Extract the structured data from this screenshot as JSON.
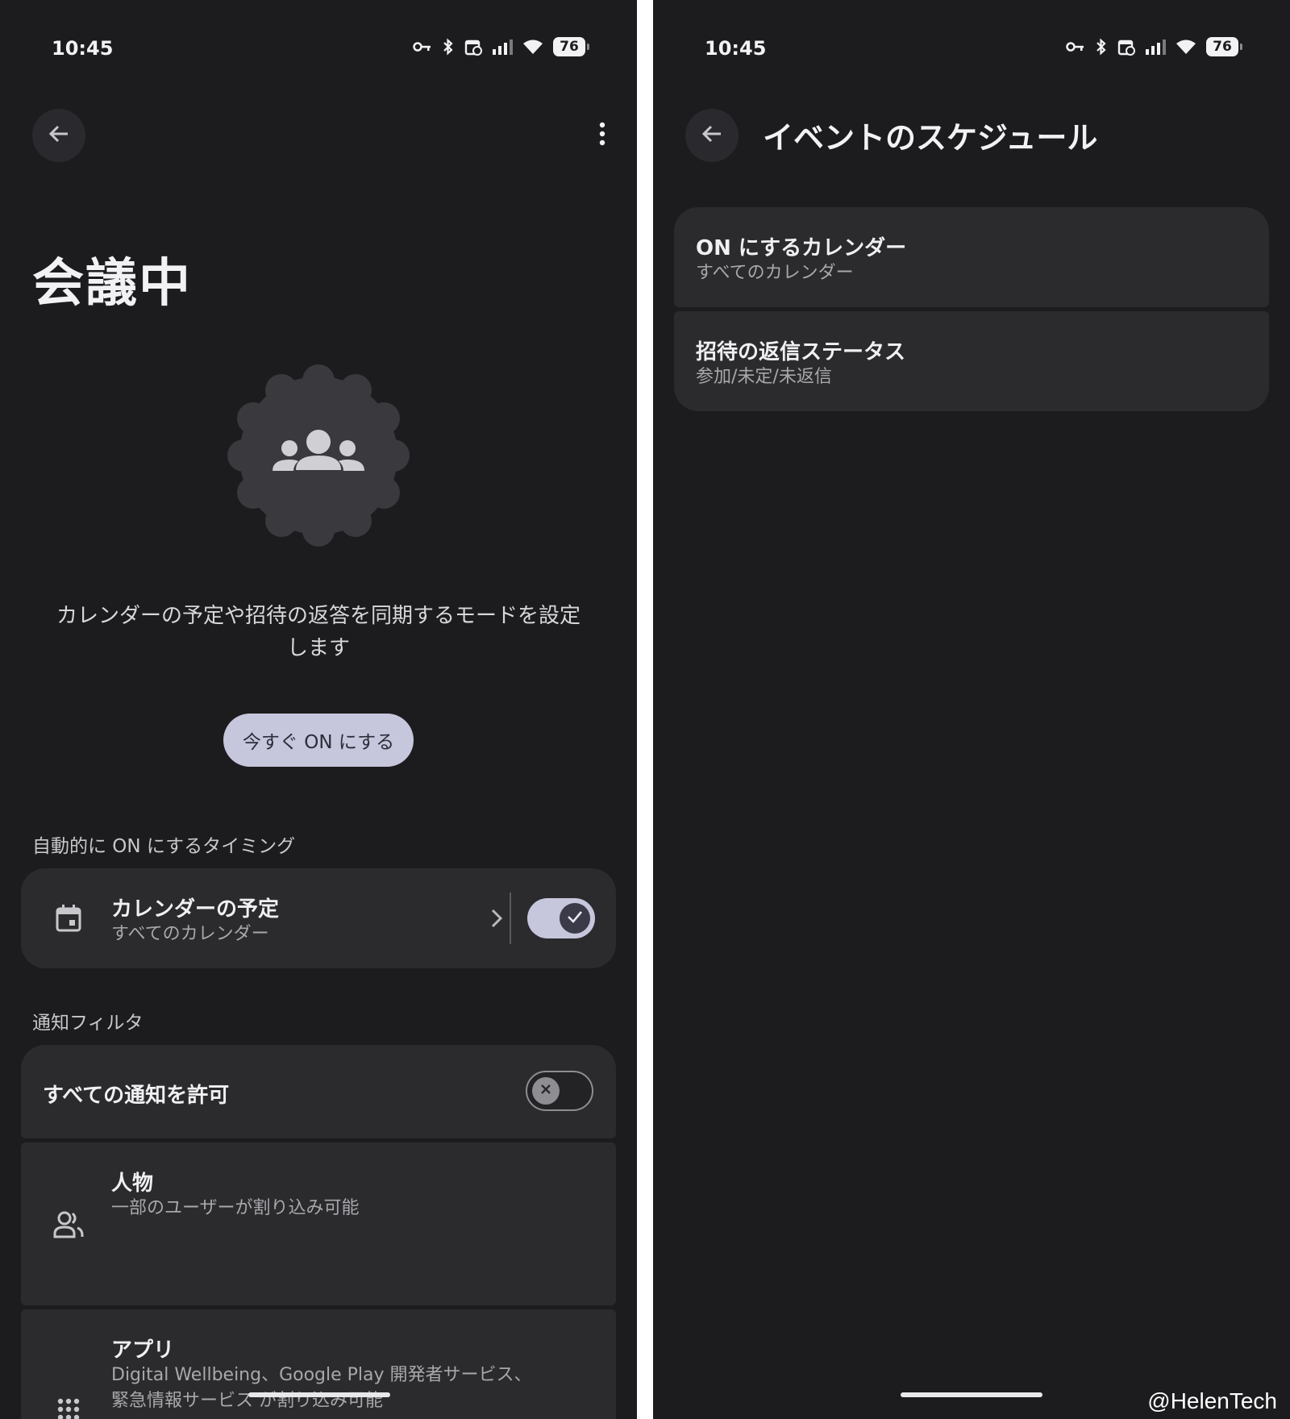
{
  "left_screen": {
    "status": {
      "time": "10:45",
      "battery": "76"
    },
    "title": "会議中",
    "description": "カレンダーの予定や招待の返答を同期するモードを設定します",
    "primary_button": "今すぐ ON にする",
    "schedule_section": {
      "label": "自動的に ON にするタイミング",
      "item": {
        "title": "カレンダーの予定",
        "subtitle": "すべてのカレンダー",
        "toggle": "on"
      }
    },
    "filter_section": {
      "label": "通知フィルタ",
      "allow_all": {
        "title": "すべての通知を許可",
        "toggle": "off"
      },
      "people": {
        "title": "人物",
        "subtitle": "一部のユーザーが割り込み可能"
      },
      "apps": {
        "title": "アプリ",
        "subtitle_line1": "Digital Wellbeing、Google Play 開発者サービス、",
        "subtitle_line2": "緊急情報サービス が割り込み可能"
      }
    }
  },
  "right_screen": {
    "status": {
      "time": "10:45",
      "battery": "76"
    },
    "title": "イベントのスケジュール",
    "items": [
      {
        "title": "ON にするカレンダー",
        "subtitle": "すべてのカレンダー"
      },
      {
        "title": "招待の返信ステータス",
        "subtitle": "参加/未定/未返信"
      }
    ]
  },
  "watermark": "@HelenTech",
  "icons": [
    "key-icon",
    "bluetooth-icon",
    "calendar-status-icon",
    "signal-icon",
    "wifi-icon",
    "back-arrow-icon",
    "more-vert-icon",
    "people-group-icon",
    "calendar-icon",
    "chevron-right-icon",
    "check-icon",
    "close-icon",
    "person-outline-icon",
    "apps-grid-icon"
  ],
  "colors": {
    "background": "#1c1c1e",
    "card": "#2b2b2e",
    "accent": "#c6c6dc",
    "divider": "#ffffff"
  }
}
